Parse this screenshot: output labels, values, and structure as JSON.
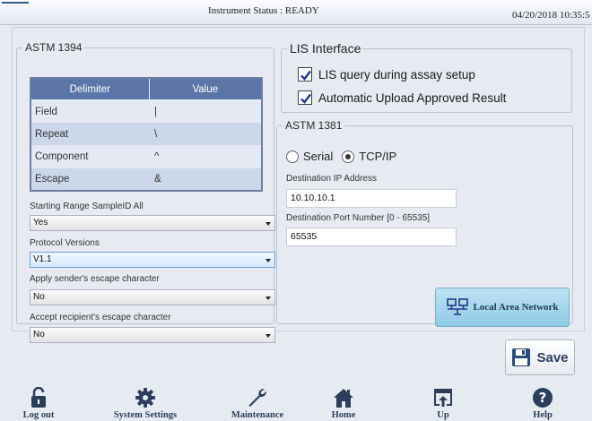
{
  "header": {
    "status": "Instrument Status : READY",
    "datetime": "04/20/2018 10:35:5"
  },
  "astm1394": {
    "title": "ASTM 1394",
    "table": {
      "headers": [
        "Delimiter",
        "Value"
      ],
      "rows": [
        {
          "delimiter": "Field",
          "value": "|"
        },
        {
          "delimiter": "Repeat",
          "value": "\\"
        },
        {
          "delimiter": "Component",
          "value": "^"
        },
        {
          "delimiter": "Escape",
          "value": "&"
        }
      ]
    },
    "starting_range": {
      "label": "Starting Range SampleID All",
      "value": "Yes"
    },
    "protocol_version": {
      "label": "Protocol Versions",
      "value": "V1.1"
    },
    "apply_escape": {
      "label": "Apply sender's escape character",
      "value": "No"
    },
    "accept_escape": {
      "label": "Accept recipient's escape character",
      "value": "No"
    }
  },
  "lis": {
    "title": "LIS Interface",
    "options": [
      {
        "label": "LIS query during assay setup",
        "checked": true
      },
      {
        "label": "Automatic Upload Approved Result",
        "checked": true
      }
    ]
  },
  "astm1381": {
    "title": "ASTM 1381",
    "radios": [
      {
        "label": "Serial",
        "selected": false
      },
      {
        "label": "TCP/IP",
        "selected": true
      }
    ],
    "ip_label": "Destination IP Address",
    "ip_value": "10.10.10.1",
    "port_label": "Destination Port Number [0 - 65535]",
    "port_value": "65535",
    "lan_button": "Local Area Network"
  },
  "save_button": "Save",
  "nav": [
    {
      "label": "Log out",
      "icon": "lock-open-icon"
    },
    {
      "label": "System Settings",
      "icon": "gear-icon"
    },
    {
      "label": "Maintenance",
      "icon": "wrench-icon"
    },
    {
      "label": "Home",
      "icon": "home-icon"
    },
    {
      "label": "Up",
      "icon": "up-icon"
    },
    {
      "label": "Help",
      "icon": "help-icon"
    }
  ],
  "colors": {
    "table_header": "#5b76a6",
    "lan_button": "#a9d8ec",
    "nav_icon": "#2c3e5a"
  }
}
